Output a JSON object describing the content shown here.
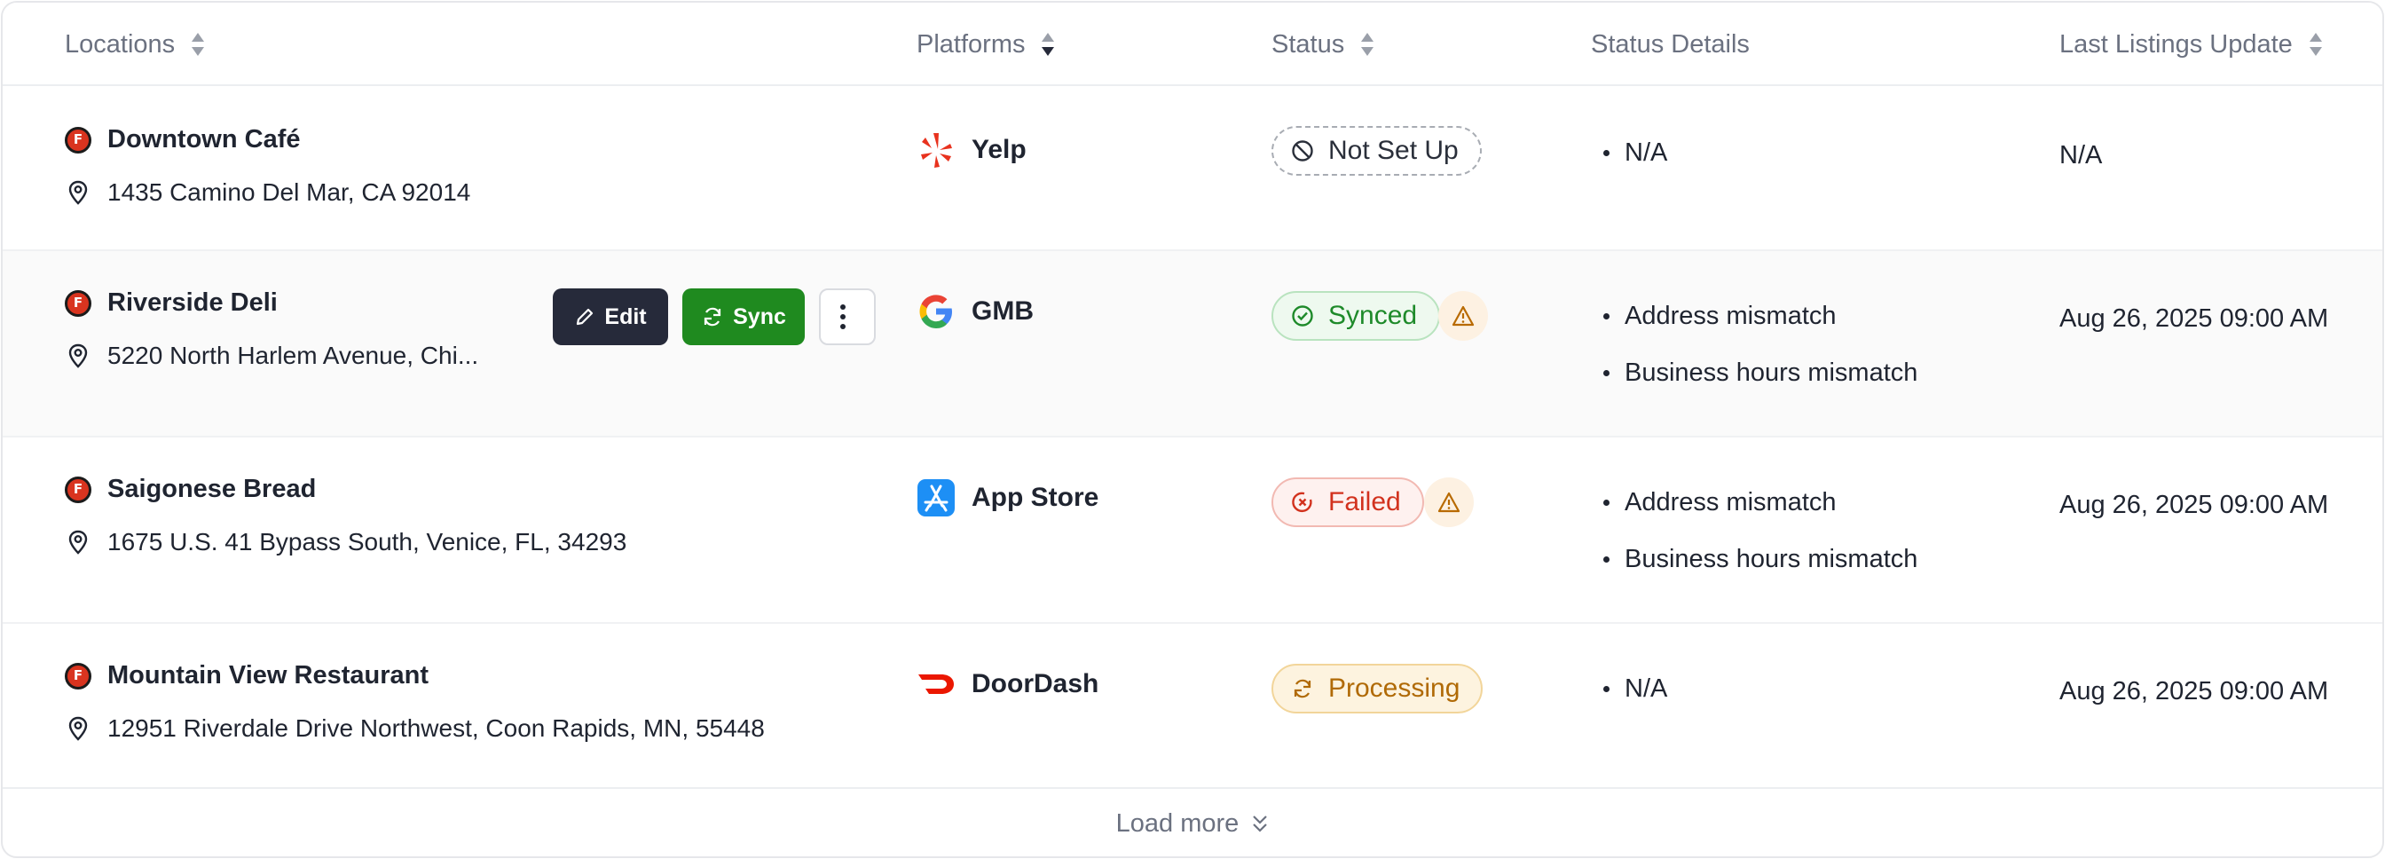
{
  "columns": {
    "locations": "Locations",
    "platforms": "Platforms",
    "status": "Status",
    "status_details": "Status Details",
    "last_update": "Last Listings Update"
  },
  "rows": [
    {
      "name": "Downtown Café",
      "address": "1435 Camino Del Mar, CA 92014",
      "platform": "Yelp",
      "platform_icon": "yelp-icon",
      "status": "Not Set Up",
      "status_icon": "ban-icon",
      "details": [
        "N/A"
      ],
      "updated": "N/A"
    },
    {
      "name": "Riverside Deli",
      "address": "5220 North Harlem Avenue, Chi...",
      "platform": "GMB",
      "platform_icon": "google-icon",
      "status": "Synced",
      "status_icon": "check-circle-icon",
      "details": [
        "Address mismatch",
        "Business hours mismatch"
      ],
      "updated": "Aug 26, 2025 09:00 AM"
    },
    {
      "name": "Saigonese Bread",
      "address": "1675 U.S. 41 Bypass South, Venice, FL, 34293",
      "platform": "App Store",
      "platform_icon": "app-store-icon",
      "status": "Failed",
      "status_icon": "failed-icon",
      "details": [
        "Address mismatch",
        "Business hours mismatch"
      ],
      "updated": "Aug 26, 2025 09:00 AM"
    },
    {
      "name": "Mountain View Restaurant",
      "address": "12951 Riverdale Drive Northwest, Coon Rapids, MN, 55448",
      "platform": "DoorDash",
      "platform_icon": "doordash-icon",
      "status": "Processing",
      "status_icon": "refresh-icon",
      "details": [
        "N/A"
      ],
      "updated": "Aug 26, 2025 09:00 AM"
    }
  ],
  "row_actions": {
    "edit": "Edit",
    "sync": "Sync"
  },
  "load_more": "Load more",
  "colors": {
    "synced": "#1e8a2a",
    "failed": "#d2321e",
    "processing": "#b06a06",
    "warning": "#b86a00",
    "sync_button": "#1f8a1f",
    "edit_button": "#262a3a"
  }
}
